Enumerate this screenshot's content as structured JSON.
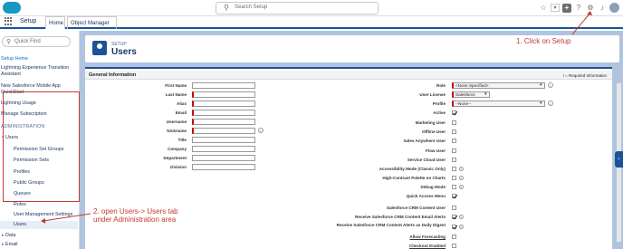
{
  "header": {
    "search_placeholder": "Search Setup",
    "icons": [
      "star-icon",
      "chevron-down-icon",
      "plus-icon",
      "help-icon",
      "gear-icon",
      "bell-icon",
      "avatar"
    ]
  },
  "nav": {
    "app_name": "Setup",
    "tabs": [
      {
        "label": "Home"
      },
      {
        "label": "Object Manager"
      }
    ],
    "om_chevron": "▾"
  },
  "sidebar": {
    "quick_find": "Quick Find",
    "items": [
      {
        "label": "Setup Home"
      },
      {
        "label": "Lightning Experience Transition Assistant"
      },
      {
        "label": "New Salesforce Mobile App QuickStart"
      },
      {
        "label": "Lightning Usage"
      },
      {
        "label": "Manage Subscription"
      },
      {
        "label": "ADMINISTRATION"
      },
      {
        "label": "Users"
      },
      {
        "label": "Permission Set Groups"
      },
      {
        "label": "Permission Sets"
      },
      {
        "label": "Profiles"
      },
      {
        "label": "Public Groups"
      },
      {
        "label": "Queues"
      },
      {
        "label": "Roles"
      },
      {
        "label": "User Management Settings"
      },
      {
        "label": "Users"
      },
      {
        "label": "Data"
      },
      {
        "label": "Email"
      }
    ]
  },
  "main": {
    "breadcrumb": "SETUP",
    "title": "Users",
    "section_title": "General Information",
    "required_note": "I = Required Information",
    "left_fields": [
      {
        "label": "First Name"
      },
      {
        "label": "Last Name"
      },
      {
        "label": "Alias"
      },
      {
        "label": "Email"
      },
      {
        "label": "Username"
      },
      {
        "label": "Nickname"
      },
      {
        "label": "Title"
      },
      {
        "label": "Company"
      },
      {
        "label": "Department"
      },
      {
        "label": "Division"
      }
    ],
    "right_fields": [
      {
        "label": "Role",
        "value": "<None Specified>"
      },
      {
        "label": "User License",
        "value": "Salesforce"
      },
      {
        "label": "Profile",
        "value": "--None--"
      },
      {
        "label": "Active",
        "checked": true
      },
      {
        "label": "Marketing User",
        "checked": false
      },
      {
        "label": "Offline User",
        "checked": false
      },
      {
        "label": "Sales Anywhere User",
        "checked": false
      },
      {
        "label": "Flow User",
        "checked": false
      },
      {
        "label": "Service Cloud User",
        "checked": false
      },
      {
        "label": "Accessibility Mode (Classic Only)",
        "checked": false
      },
      {
        "label": "High-Contrast Palette on Charts",
        "checked": false
      },
      {
        "label": "Debug Mode",
        "checked": false
      },
      {
        "label": "Quick Access Menu",
        "checked": true
      },
      {
        "label": "Salesforce CRM Content User",
        "checked": false
      },
      {
        "label": "Receive Salesforce CRM Content Email Alerts",
        "checked": true
      },
      {
        "label": "Receive Salesforce CRM Content Alerts as Daily Digest",
        "checked": true
      },
      {
        "label": "Allow Forecasting",
        "checked": false
      },
      {
        "label": "Checkout Enabled",
        "checked": false
      }
    ]
  },
  "annotations": {
    "step1": "1. Click on Setup",
    "step2_line1": "2. open Users-> Users tab",
    "step2_line2": "under Administration area",
    "color": "#c23934"
  }
}
